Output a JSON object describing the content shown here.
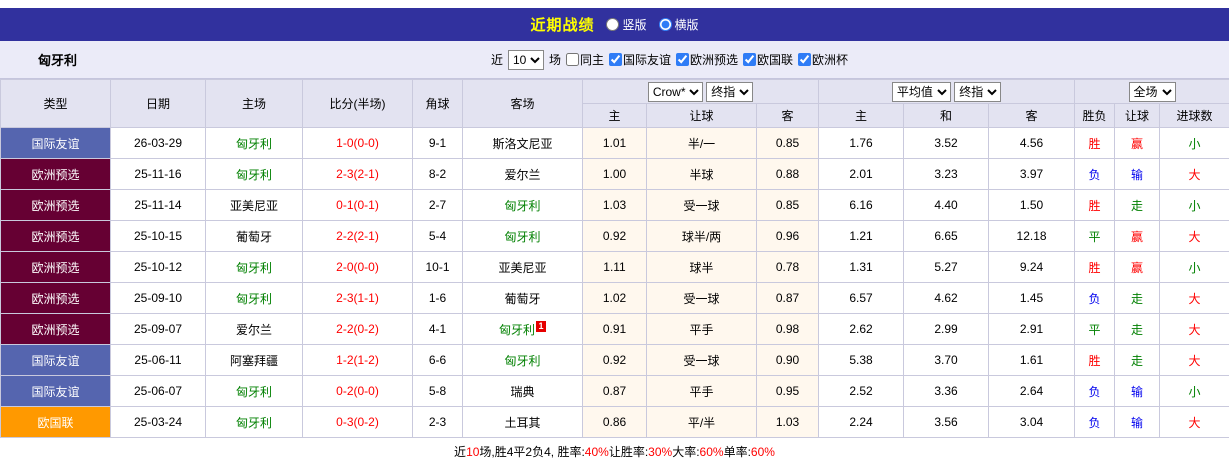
{
  "title_bar": {
    "title": "近期战绩",
    "radios": [
      {
        "label": "竖版",
        "checked": false
      },
      {
        "label": "横版",
        "checked": true
      }
    ]
  },
  "filter_bar": {
    "team": "匈牙利",
    "near_label": "近",
    "match_count": "10",
    "unit_label": "场",
    "checkboxes": [
      {
        "label": "同主",
        "checked": false
      },
      {
        "label": "国际友谊",
        "checked": true
      },
      {
        "label": "欧洲预选",
        "checked": true
      },
      {
        "label": "欧国联",
        "checked": true
      },
      {
        "label": "欧洲杯",
        "checked": true
      }
    ]
  },
  "table": {
    "static_headers": [
      "类型",
      "日期",
      "主场",
      "比分(半场)",
      "角球",
      "客场"
    ],
    "odds_group1": {
      "selects": [
        "Crow*",
        "终指"
      ],
      "columns": [
        "主",
        "让球",
        "客"
      ]
    },
    "odds_group2": {
      "selects": [
        "平均值",
        "终指"
      ],
      "columns": [
        "主",
        "和",
        "客"
      ]
    },
    "result_group": {
      "selects": [
        "全场"
      ],
      "columns": [
        "胜负",
        "让球",
        "进球数"
      ]
    },
    "rows": [
      {
        "type": "国际友谊",
        "date": "26-03-29",
        "home": "匈牙利",
        "score": "1-0(0-0)",
        "corners": "9-1",
        "away": "斯洛文尼亚",
        "odds1": [
          "1.01",
          "半/一",
          "0.85"
        ],
        "odds2": [
          "1.76",
          "3.52",
          "4.56"
        ],
        "results": [
          "胜",
          "赢",
          "小"
        ]
      },
      {
        "type": "欧洲预选",
        "date": "25-11-16",
        "home": "匈牙利",
        "score": "2-3(2-1)",
        "corners": "8-2",
        "away": "爱尔兰",
        "odds1": [
          "1.00",
          "半球",
          "0.88"
        ],
        "odds2": [
          "2.01",
          "3.23",
          "3.97"
        ],
        "results": [
          "负",
          "输",
          "大"
        ]
      },
      {
        "type": "欧洲预选",
        "date": "25-11-14",
        "home": "亚美尼亚",
        "score": "0-1(0-1)",
        "corners": "2-7",
        "away": "匈牙利",
        "odds1": [
          "1.03",
          "受一球",
          "0.85"
        ],
        "odds2": [
          "6.16",
          "4.40",
          "1.50"
        ],
        "results": [
          "胜",
          "走",
          "小"
        ]
      },
      {
        "type": "欧洲预选",
        "date": "25-10-15",
        "home": "葡萄牙",
        "score": "2-2(2-1)",
        "corners": "5-4",
        "away": "匈牙利",
        "odds1": [
          "0.92",
          "球半/两",
          "0.96"
        ],
        "odds2": [
          "1.21",
          "6.65",
          "12.18"
        ],
        "results": [
          "平",
          "赢",
          "大"
        ]
      },
      {
        "type": "欧洲预选",
        "date": "25-10-12",
        "home": "匈牙利",
        "score": "2-0(0-0)",
        "corners": "10-1",
        "away": "亚美尼亚",
        "odds1": [
          "1.11",
          "球半",
          "0.78"
        ],
        "odds2": [
          "1.31",
          "5.27",
          "9.24"
        ],
        "results": [
          "胜",
          "赢",
          "小"
        ]
      },
      {
        "type": "欧洲预选",
        "date": "25-09-10",
        "home": "匈牙利",
        "score": "2-3(1-1)",
        "corners": "1-6",
        "away": "葡萄牙",
        "odds1": [
          "1.02",
          "受一球",
          "0.87"
        ],
        "odds2": [
          "6.57",
          "4.62",
          "1.45"
        ],
        "results": [
          "负",
          "走",
          "大"
        ]
      },
      {
        "type": "欧洲预选",
        "date": "25-09-07",
        "home": "爱尔兰",
        "score": "2-2(0-2)",
        "corners": "4-1",
        "away": "匈牙利",
        "away_badge": "1",
        "odds1": [
          "0.91",
          "平手",
          "0.98"
        ],
        "odds2": [
          "2.62",
          "2.99",
          "2.91"
        ],
        "results": [
          "平",
          "走",
          "大"
        ]
      },
      {
        "type": "国际友谊",
        "date": "25-06-11",
        "home": "阿塞拜疆",
        "score": "1-2(1-2)",
        "corners": "6-6",
        "away": "匈牙利",
        "odds1": [
          "0.92",
          "受一球",
          "0.90"
        ],
        "odds2": [
          "5.38",
          "3.70",
          "1.61"
        ],
        "results": [
          "胜",
          "走",
          "大"
        ]
      },
      {
        "type": "国际友谊",
        "date": "25-06-07",
        "home": "匈牙利",
        "score": "0-2(0-0)",
        "corners": "5-8",
        "away": "瑞典",
        "odds1": [
          "0.87",
          "平手",
          "0.95"
        ],
        "odds2": [
          "2.52",
          "3.36",
          "2.64"
        ],
        "results": [
          "负",
          "输",
          "小"
        ]
      },
      {
        "type": "欧国联",
        "date": "25-03-24",
        "home": "匈牙利",
        "score": "0-3(0-2)",
        "corners": "2-3",
        "away": "土耳其",
        "odds1": [
          "0.86",
          "平/半",
          "1.03"
        ],
        "odds2": [
          "2.24",
          "3.56",
          "3.04"
        ],
        "results": [
          "负",
          "输",
          "大"
        ]
      }
    ]
  },
  "colors": {
    "badge": {
      "国际友谊": "#5565af",
      "欧洲预选": "#660033",
      "欧国联": "#ff9900"
    },
    "result": {
      "胜": "#ff0000",
      "负": "#0000ee",
      "平": "#008000",
      "赢": "#ff0000",
      "输": "#0000ee",
      "走": "#008000",
      "大": "#ff0000",
      "小": "#008000"
    },
    "team_highlight": "#008000",
    "score": "#ff0000"
  },
  "footer": {
    "segments": [
      {
        "text": "近",
        "color": "#000000"
      },
      {
        "text": "10",
        "color": "#ff0000"
      },
      {
        "text": "场,胜4平2负4, 胜率:",
        "color": "#000000"
      },
      {
        "text": "40%",
        "color": "#ff0000"
      },
      {
        "text": " 让胜率:",
        "color": "#000000"
      },
      {
        "text": "30%",
        "color": "#ff0000"
      },
      {
        "text": " 大率:",
        "color": "#000000"
      },
      {
        "text": "60%",
        "color": "#ff0000"
      },
      {
        "text": " 单率:",
        "color": "#000000"
      },
      {
        "text": "60%",
        "color": "#ff0000"
      }
    ]
  }
}
